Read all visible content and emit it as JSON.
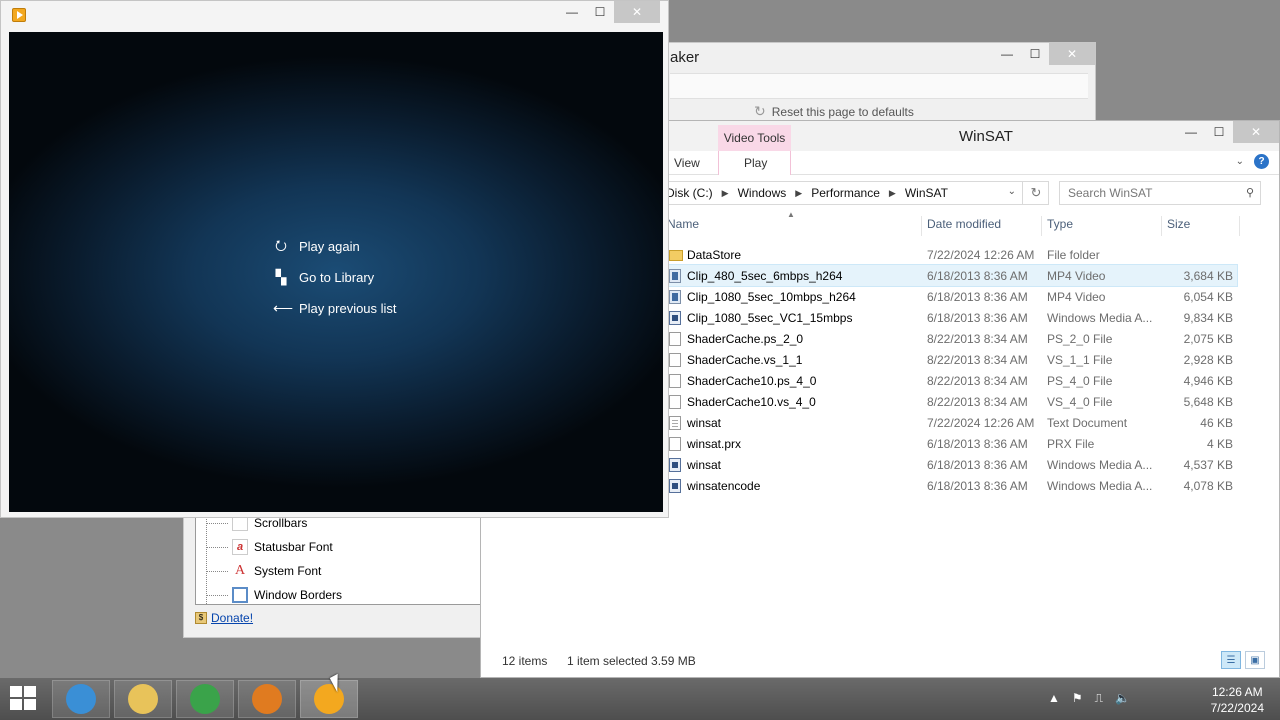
{
  "tweaker_window": {
    "title": "aker",
    "reset_label": "Reset this page to defaults",
    "tree_items": [
      {
        "label": "Scrollbars",
        "icon": "scrollbars-icon"
      },
      {
        "label": "Statusbar Font",
        "icon": "font-icon"
      },
      {
        "label": "System Font",
        "icon": "font-icon"
      },
      {
        "label": "Window Borders",
        "icon": "window-borders-icon"
      }
    ],
    "donate_label": "Donate!"
  },
  "explorer": {
    "title": "WinSAT",
    "context_tab": "Video Tools",
    "ribbon_tabs": [
      "View",
      "Play"
    ],
    "breadcrumb": [
      "Disk (C:)",
      "Windows",
      "Performance",
      "WinSAT"
    ],
    "search_placeholder": "Search WinSAT",
    "columns": [
      "Name",
      "Date modified",
      "Type",
      "Size"
    ],
    "files": [
      {
        "name": "DataStore",
        "date": "7/22/2024 12:26 AM",
        "type": "File folder",
        "size": "",
        "icon": "folder",
        "selected": false
      },
      {
        "name": "Clip_480_5sec_6mbps_h264",
        "date": "6/18/2013 8:36 AM",
        "type": "MP4 Video",
        "size": "3,684 KB",
        "icon": "vid",
        "selected": true
      },
      {
        "name": "Clip_1080_5sec_10mbps_h264",
        "date": "6/18/2013 8:36 AM",
        "type": "MP4 Video",
        "size": "6,054 KB",
        "icon": "vid",
        "selected": false
      },
      {
        "name": "Clip_1080_5sec_VC1_15mbps",
        "date": "6/18/2013 8:36 AM",
        "type": "Windows Media A...",
        "size": "9,834 KB",
        "icon": "wma",
        "selected": false
      },
      {
        "name": "ShaderCache.ps_2_0",
        "date": "8/22/2013 8:34 AM",
        "type": "PS_2_0 File",
        "size": "2,075 KB",
        "icon": "file",
        "selected": false
      },
      {
        "name": "ShaderCache.vs_1_1",
        "date": "8/22/2013 8:34 AM",
        "type": "VS_1_1 File",
        "size": "2,928 KB",
        "icon": "file",
        "selected": false
      },
      {
        "name": "ShaderCache10.ps_4_0",
        "date": "8/22/2013 8:34 AM",
        "type": "PS_4_0 File",
        "size": "4,946 KB",
        "icon": "file",
        "selected": false
      },
      {
        "name": "ShaderCache10.vs_4_0",
        "date": "8/22/2013 8:34 AM",
        "type": "VS_4_0 File",
        "size": "5,648 KB",
        "icon": "file",
        "selected": false
      },
      {
        "name": "winsat",
        "date": "7/22/2024 12:26 AM",
        "type": "Text Document",
        "size": "46 KB",
        "icon": "txt",
        "selected": false
      },
      {
        "name": "winsat.prx",
        "date": "6/18/2013 8:36 AM",
        "type": "PRX File",
        "size": "4 KB",
        "icon": "file",
        "selected": false
      },
      {
        "name": "winsat",
        "date": "6/18/2013 8:36 AM",
        "type": "Windows Media A...",
        "size": "4,537 KB",
        "icon": "wma",
        "selected": false
      },
      {
        "name": "winsatencode",
        "date": "6/18/2013 8:36 AM",
        "type": "Windows Media A...",
        "size": "4,078 KB",
        "icon": "wma",
        "selected": false
      }
    ],
    "status_items": "12 items",
    "status_selected": "1 item selected  3.59 MB"
  },
  "player": {
    "menu": [
      {
        "label": "Play again",
        "icon": "replay-icon",
        "glyph": "⭮"
      },
      {
        "label": "Go to Library",
        "icon": "library-icon",
        "glyph": "▚"
      },
      {
        "label": "Play previous list",
        "icon": "back-arrow-icon",
        "glyph": "⟵"
      }
    ]
  },
  "taskbar": {
    "apps": [
      {
        "name": "internet-explorer-icon",
        "color": "#3a8fd6"
      },
      {
        "name": "file-explorer-icon",
        "color": "#e8c35a"
      },
      {
        "name": "download-manager-icon",
        "color": "#3aa34a"
      },
      {
        "name": "firefox-icon",
        "color": "#e07b20"
      },
      {
        "name": "media-player-icon",
        "color": "#f3a81f"
      }
    ],
    "time": "12:26 AM",
    "date": "7/22/2024"
  }
}
